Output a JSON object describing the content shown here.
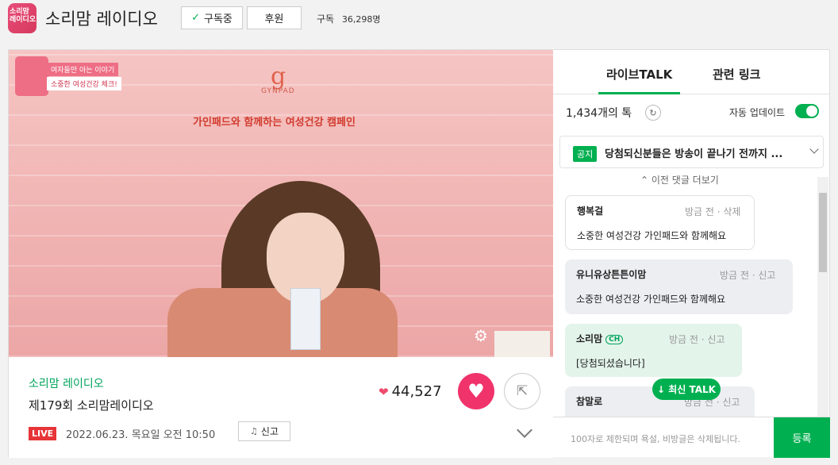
{
  "header": {
    "logo_text": "소리맘 레이디오",
    "channel_title": "소리맘 레이디오",
    "subscribe_label": "구독중",
    "support_label": "후원",
    "subs_label": "구독",
    "subs_count": "36,298명"
  },
  "video": {
    "tag1": "여자들만 아는 이야기",
    "tag2": "소중한 여성건강 체크!",
    "brand_mark": "g",
    "brand_name": "GYNPAD",
    "campaign": "가인패드와 함께하는 여성건강 캠페인"
  },
  "info": {
    "channel_link": "소리맘 레이디오",
    "episode_title": "제179회  소리맘레이디오",
    "live_label": "LIVE",
    "date": "2022.06.23. 목요일 오전 10:50",
    "report_label": "신고",
    "likes": "44,527"
  },
  "chat": {
    "tabs": [
      "라이브TALK",
      "관련 링크"
    ],
    "talk_count": "1,434개의 톡",
    "auto_update": "자동 업데이트",
    "notice_tag": "공지",
    "notice_text": "당첨되신분들은 방송이 끝나기 전까지 ...",
    "more": "이전 댓글 더보기",
    "messages": [
      {
        "name": "행복걸",
        "meta": "방금 전 · 삭제",
        "text": "소중한 여성건강 가인패드와 함께해요"
      },
      {
        "name": "유니유상튼튼이맘",
        "meta": "방금 전 · 신고",
        "text": "소중한 여성건강 가인패드와 함께해요"
      },
      {
        "name": "소리맘",
        "badge": "CH",
        "meta": "방금 전 · 신고",
        "text": "[당첨되셨습니다]"
      },
      {
        "name": "참말로",
        "meta": "방금 전 · 신고",
        "text": ""
      }
    ],
    "newest_label": "최신 TALK",
    "input_placeholder": "100자로 제한되며 욕설, 비방글은 삭제됩니다.",
    "register_label": "등록"
  },
  "colors": {
    "accent": "#00b050",
    "live": "#e63438",
    "like": "#f0336b"
  }
}
